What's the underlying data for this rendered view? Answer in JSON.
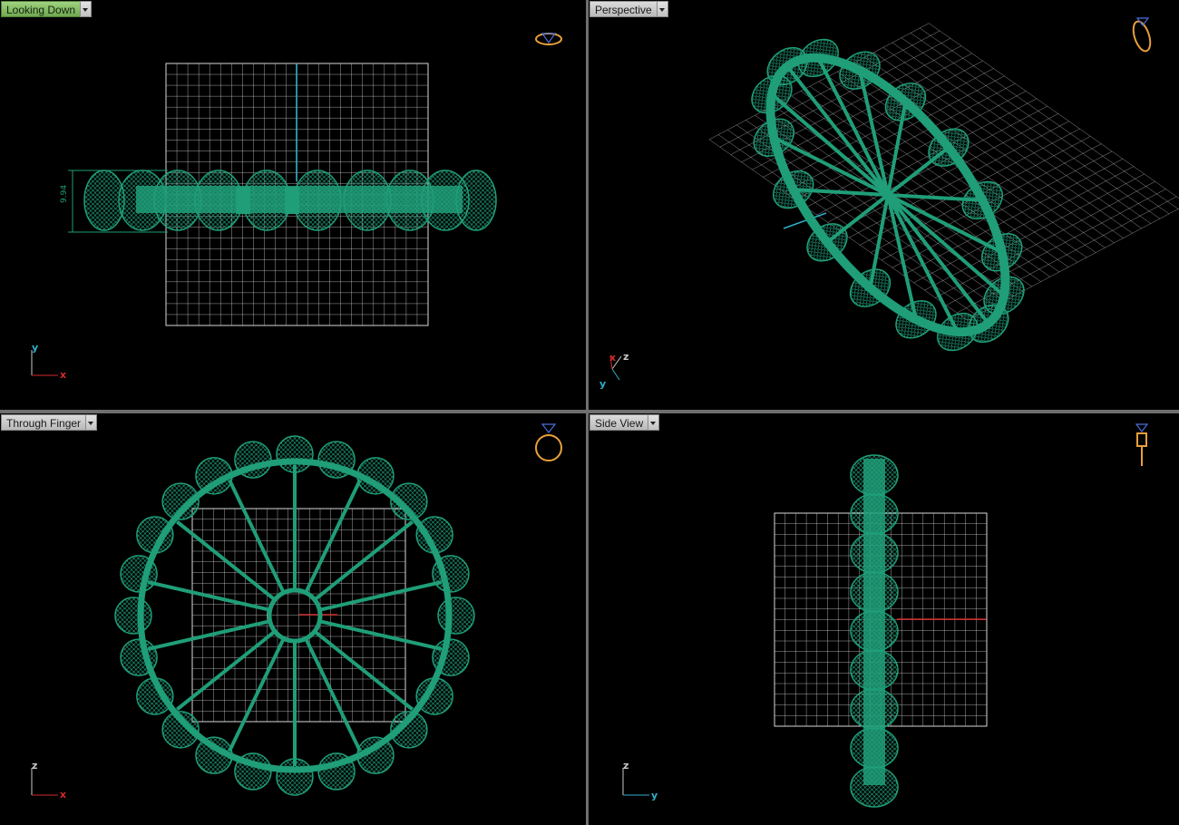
{
  "viewports": {
    "top": {
      "title": "Looking Down",
      "active": true,
      "dimension": "9.94",
      "axes": [
        "y",
        "x"
      ]
    },
    "persp": {
      "title": "Perspective",
      "active": false,
      "axes": [
        "z",
        "x",
        "y"
      ]
    },
    "front": {
      "title": "Through Finger",
      "active": false,
      "axes": [
        "z",
        "x"
      ]
    },
    "side": {
      "title": "Side View",
      "active": false,
      "axes": [
        "z",
        "y"
      ]
    }
  },
  "colors": {
    "viewport_bg": "#000000",
    "model": "#1f9e78",
    "grid": "#d8d8d8",
    "axis_x": "#d02a2a",
    "axis_y": "#2fb0c8",
    "axis_z": "#c8c8c8",
    "widget": "#e8a03a",
    "gem": "#4a6fd8"
  },
  "icons": {
    "top": "ring-top-view-icon",
    "persp": "ring-perspective-icon",
    "front": "ring-front-view-icon",
    "side": "ring-side-view-icon"
  }
}
